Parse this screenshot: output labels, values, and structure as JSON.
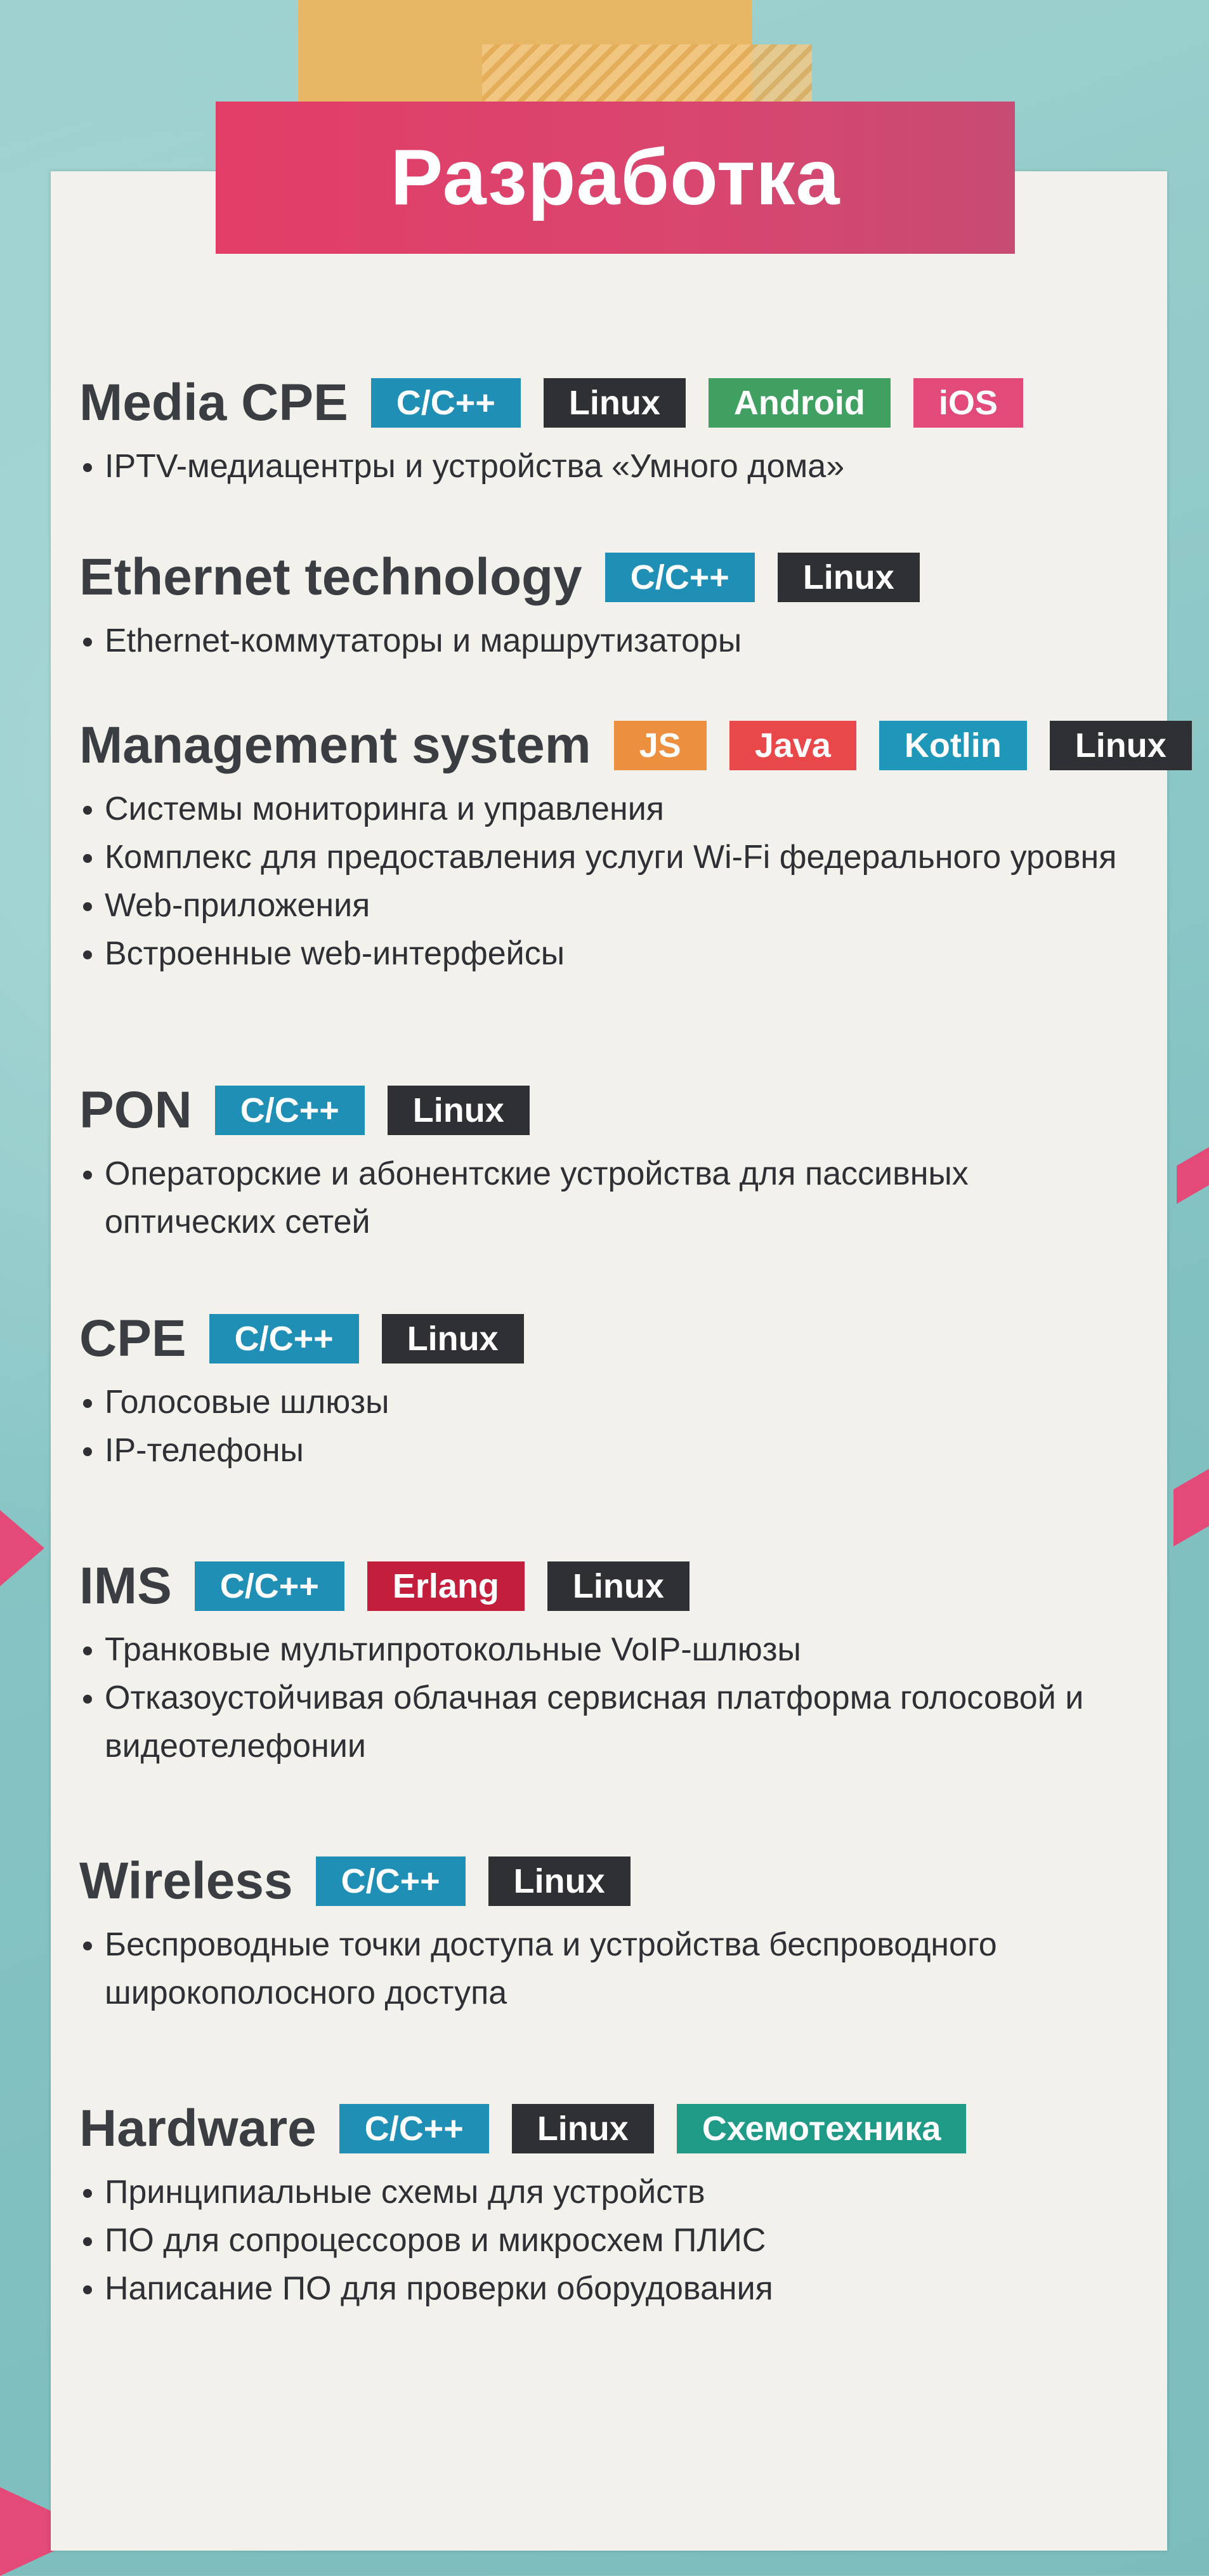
{
  "colors": {
    "cpp": "#1f8fb5",
    "linux": "#2f3034",
    "android": "#3fa062",
    "ios": "#e24a7a",
    "js": "#ec8f3f",
    "java": "#e8484a",
    "kotlin": "#1f97b8",
    "erlang": "#c31e3c",
    "schemotech": "#1f9a86",
    "banner": "#e23d67",
    "card": "#f2f1ec",
    "background": "#8fc9c9"
  },
  "title": "Разработка",
  "sections": [
    {
      "name": "Media CPE",
      "tags": [
        {
          "label": "C/C++",
          "color": "#1f8fb5"
        },
        {
          "label": "Linux",
          "color": "#2f3034"
        },
        {
          "label": "Android",
          "color": "#3fa062"
        },
        {
          "label": "iOS",
          "color": "#e24a7a"
        }
      ],
      "bullets": [
        "IPTV-медиацентры и устройства «Умного дома»"
      ]
    },
    {
      "name": "Ethernet technology",
      "tags": [
        {
          "label": "C/C++",
          "color": "#1f8fb5"
        },
        {
          "label": "Linux",
          "color": "#2f3034"
        }
      ],
      "bullets": [
        "Ethernet-коммутаторы и маршрутизаторы"
      ]
    },
    {
      "name": "Management system",
      "tags": [
        {
          "label": "JS",
          "color": "#ec8f3f"
        },
        {
          "label": "Java",
          "color": "#e8484a"
        },
        {
          "label": "Kotlin",
          "color": "#1f97b8"
        },
        {
          "label": "Linux",
          "color": "#2f3034"
        }
      ],
      "bullets": [
        "Системы мониторинга и управления",
        "Комплекс для предоставления услуги Wi-Fi федерального уровня",
        "Web-приложения",
        "Встроенные web-интерфейсы"
      ]
    },
    {
      "name": "PON",
      "tags": [
        {
          "label": "C/C++",
          "color": "#1f8fb5"
        },
        {
          "label": "Linux",
          "color": "#2f3034"
        }
      ],
      "bullets": [
        "Операторские и абонентские устройства для пассивных оптических сетей"
      ]
    },
    {
      "name": "CPE",
      "tags": [
        {
          "label": "C/C++",
          "color": "#1f8fb5"
        },
        {
          "label": "Linux",
          "color": "#2f3034"
        }
      ],
      "bullets": [
        "Голосовые шлюзы",
        "IP-телефоны"
      ]
    },
    {
      "name": "IMS",
      "tags": [
        {
          "label": "C/C++",
          "color": "#1f8fb5"
        },
        {
          "label": "Erlang",
          "color": "#c31e3c"
        },
        {
          "label": "Linux",
          "color": "#2f3034"
        }
      ],
      "bullets": [
        "Транковые мультипротокольные VoIP-шлюзы",
        "Отказоустойчивая облачная сервисная платформа голосовой и видеотелефонии"
      ]
    },
    {
      "name": "Wireless",
      "tags": [
        {
          "label": "C/C++",
          "color": "#1f8fb5"
        },
        {
          "label": "Linux",
          "color": "#2f3034"
        }
      ],
      "bullets": [
        "Беспроводные точки доступа и устройства беспроводного широкополосного доступа"
      ]
    },
    {
      "name": "Hardware",
      "tags": [
        {
          "label": "C/C++",
          "color": "#1f8fb5"
        },
        {
          "label": "Linux",
          "color": "#2f3034"
        },
        {
          "label": "Схемотехника",
          "color": "#1f9a86"
        }
      ],
      "bullets": [
        "Принципиальные схемы для устройств",
        "ПО для сопроцессоров и микросхем ПЛИС",
        "Написание ПО для проверки оборудования"
      ]
    }
  ]
}
